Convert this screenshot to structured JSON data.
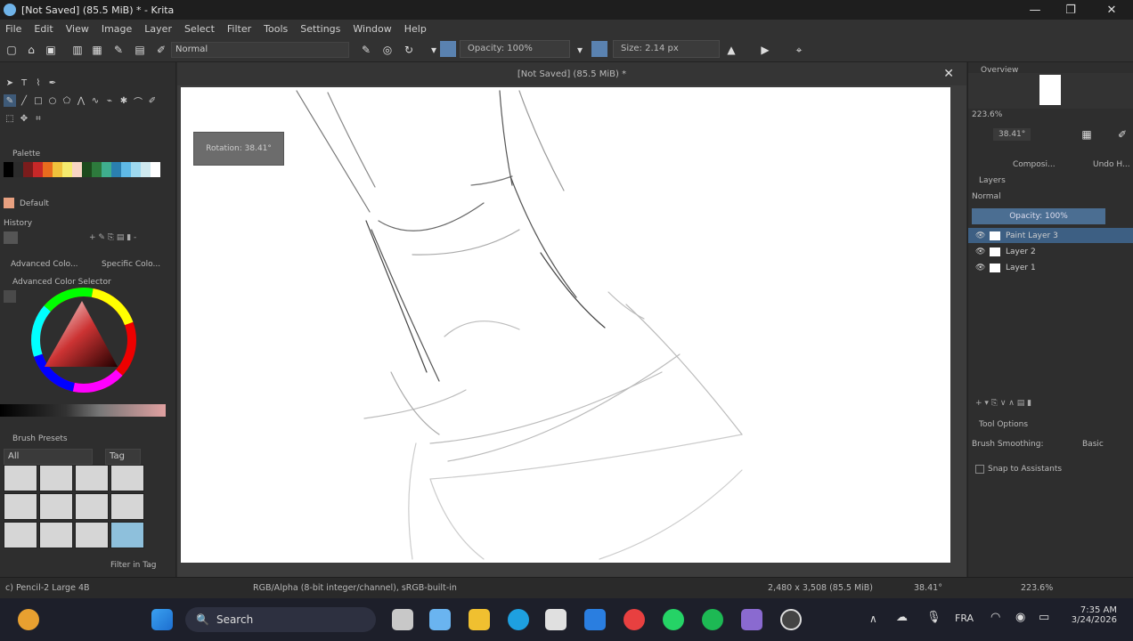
{
  "window": {
    "title": "[Not Saved] (85.5 MiB) * - Krita",
    "minimize": "—",
    "maximize": "❐",
    "close": "✕"
  },
  "menu": [
    "File",
    "Edit",
    "View",
    "Image",
    "Layer",
    "Select",
    "Filter",
    "Tools",
    "Settings",
    "Window",
    "Help"
  ],
  "toolbar": {
    "blend_mode": "Normal",
    "opacity_label": "Opacity: 100%",
    "size_label": "Size: 2.14 px",
    "accent_color": "#5a82b0"
  },
  "left_panel": {
    "toolbox_icons": [
      "pointer",
      "text",
      "edit-shapes",
      "calligraphy",
      "freehand-brush",
      "line",
      "rectangle",
      "ellipse",
      "polygon",
      "polyline",
      "bezier",
      "dynamic-brush",
      "multibrush",
      "transform",
      "move"
    ],
    "palette_title": "Palette",
    "palette_name": "Default",
    "palette_swatches": [
      "#000000",
      "#2b2b2b",
      "#7a1c1c",
      "#c82828",
      "#e86c1e",
      "#f0c23c",
      "#f5eb6e",
      "#f9d5c4",
      "#1d4a1d",
      "#2d7a3c",
      "#3fae8e",
      "#2a7fb0",
      "#5fb9e6",
      "#9ed9ef",
      "#cfe9ef",
      "#ffffff"
    ],
    "history_tab": "History",
    "adv_color_tab": "Advanced Colo...",
    "specific_color_tab": "Specific Colo...",
    "adv_color_title": "Advanced Color Selector",
    "brush_presets_title": "Brush Presets",
    "brush_filter": "All",
    "brush_tag_search": "Tag",
    "filter_in_tag": "Filter in Tag"
  },
  "canvas": {
    "tab_title": "[Not Saved] (85.5 MiB) *",
    "tooltip": "Rotation: 38.41°"
  },
  "right_panel": {
    "overview_title": "Overview",
    "zoom_title": "223.6%",
    "rotation_value": "38.41°",
    "compositions_tab": "Composi...",
    "undo_tab": "Undo H...",
    "layers_title": "Layers",
    "layer_blend": "Normal",
    "layer_opacity": "Opacity: 100%",
    "layers": [
      {
        "name": "Paint Layer 3",
        "selected": true
      },
      {
        "name": "Layer 2",
        "selected": false
      },
      {
        "name": "Layer 1",
        "selected": false
      }
    ],
    "tool_options_title": "Tool Options",
    "brush_smoothing_label": "Brush Smoothing:",
    "brush_smoothing_value": "Basic",
    "snap_label": "Snap to Assistants"
  },
  "status": {
    "brush": "c) Pencil-2 Large 4B",
    "color_space": "RGB/Alpha (8-bit integer/channel), sRGB-built-in",
    "dimensions": "2,480 x 3,508 (85.5 MiB)",
    "rotation": "38.41°",
    "zoom": "223.6%"
  },
  "taskbar": {
    "search_placeholder": "Search",
    "language": "FRA",
    "time": "7:35 AM",
    "date": "3/24/2026"
  }
}
